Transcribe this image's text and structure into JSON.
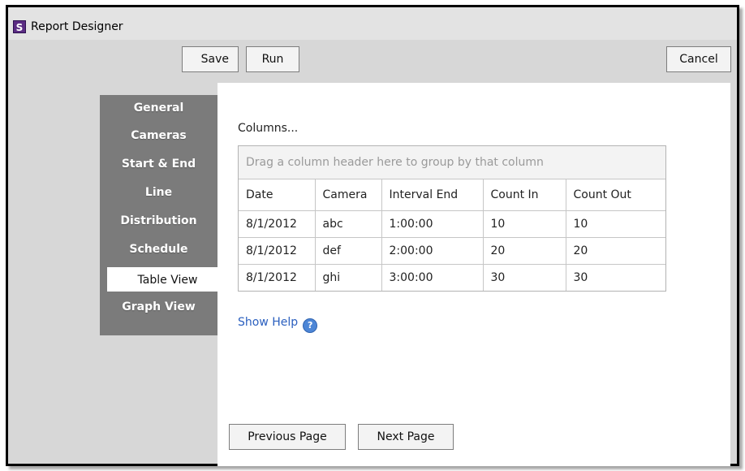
{
  "window": {
    "title": "Report Designer",
    "icon_letter": "S",
    "icon_color": "#5b2c83"
  },
  "toolbar": {
    "save_label": "Save",
    "run_label": "Run",
    "cancel_label": "Cancel"
  },
  "sidebar": {
    "items": [
      {
        "label": "General"
      },
      {
        "label": "Cameras"
      },
      {
        "label": "Start & End"
      },
      {
        "label": "Line"
      },
      {
        "label": "Distribution"
      },
      {
        "label": "Schedule"
      },
      {
        "label": "Table View"
      },
      {
        "label": "Graph View"
      }
    ],
    "active": "Table View"
  },
  "main": {
    "columns_label": "Columns...",
    "group_placeholder": "Drag a column header here to group by that column",
    "table": {
      "headers": [
        "Date",
        "Camera",
        "Interval End",
        "Count In",
        "Count Out"
      ],
      "rows": [
        [
          "8/1/2012",
          "abc",
          "1:00:00",
          "10",
          "10"
        ],
        [
          "8/1/2012",
          "def",
          "2:00:00",
          "20",
          "20"
        ],
        [
          "8/1/2012",
          "ghi",
          "3:00:00",
          "30",
          "30"
        ]
      ]
    },
    "show_help": "Show Help",
    "help_icon_glyph": "?",
    "prev_label": "Previous Page",
    "next_label": "Next Page"
  }
}
